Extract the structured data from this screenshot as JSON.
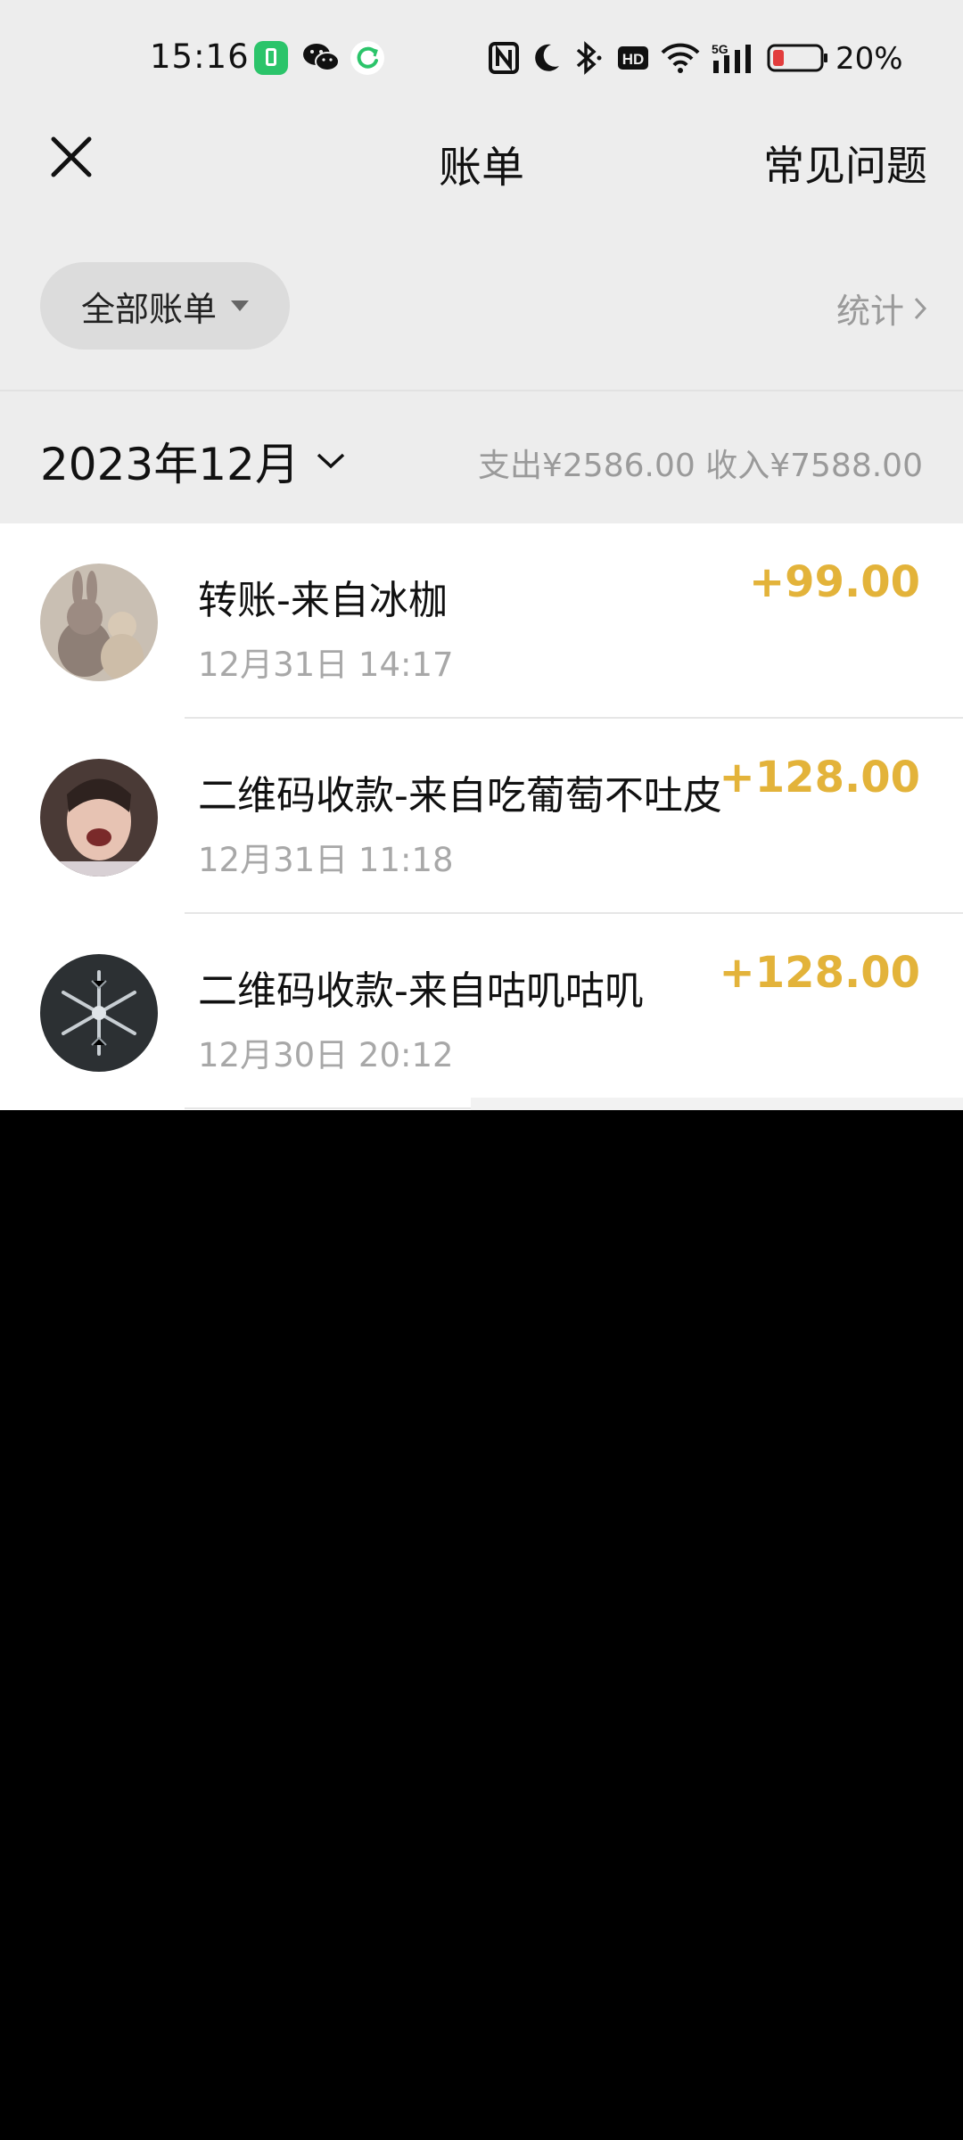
{
  "status_bar": {
    "time": "15:16",
    "battery": "20%",
    "icons": [
      "battery-app-icon",
      "wechat-icon",
      "refresh-app-icon",
      "nfc-icon",
      "do-not-disturb-icon",
      "bluetooth-icon",
      "hd-icon",
      "wifi-icon",
      "5g-signal-icon",
      "battery-icon"
    ]
  },
  "nav": {
    "title": "账单",
    "faq": "常见问题",
    "close_icon": "close-icon"
  },
  "filter": {
    "label": "全部账单",
    "stats": "统计"
  },
  "month": {
    "label": "2023年12月",
    "summary": "支出¥2586.00 收入¥7588.00"
  },
  "transactions": [
    {
      "title": "转账-来自冰枷",
      "time": "12月31日 14:17",
      "amount": "+99.00"
    },
    {
      "title": "二维码收款-来自吃葡萄不吐皮",
      "time": "12月31日 11:18",
      "amount": "+128.00"
    },
    {
      "title": "二维码收款-来自咕叽咕叽",
      "time": "12月30日 20:12",
      "amount": "+128.00"
    }
  ],
  "colors": {
    "amount": "#e3b33a",
    "background": "#ededed",
    "list_bg": "#ffffff",
    "muted_text": "#9a9a9a"
  }
}
